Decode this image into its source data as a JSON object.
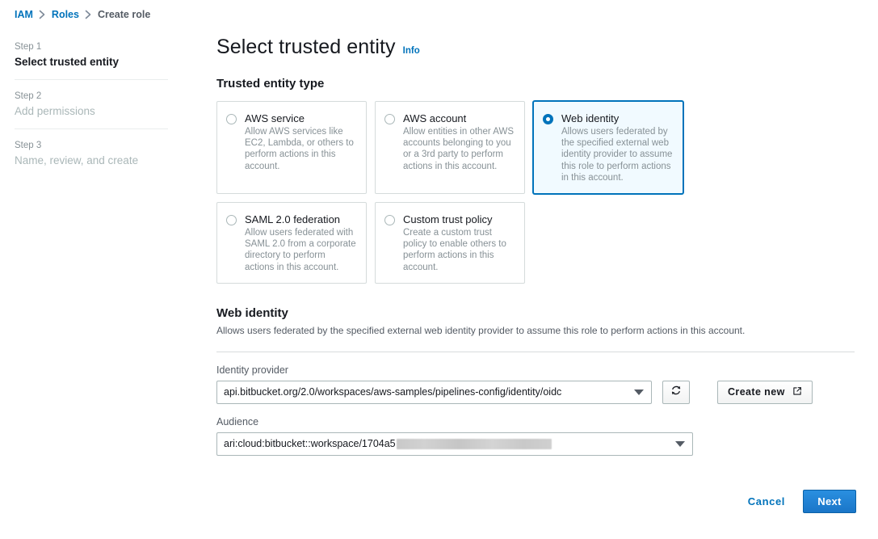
{
  "breadcrumb": {
    "items": [
      {
        "label": "IAM",
        "current": false
      },
      {
        "label": "Roles",
        "current": false
      },
      {
        "label": "Create role",
        "current": true
      }
    ]
  },
  "sidebar": {
    "steps": [
      {
        "kicker": "Step 1",
        "title": "Select trusted entity",
        "active": true
      },
      {
        "kicker": "Step 2",
        "title": "Add permissions",
        "active": false
      },
      {
        "kicker": "Step 3",
        "title": "Name, review, and create",
        "active": false
      }
    ]
  },
  "page": {
    "title": "Select trusted entity",
    "info_label": "Info",
    "section_heading": "Trusted entity type"
  },
  "entity_types": [
    {
      "title": "AWS service",
      "description": "Allow AWS services like EC2, Lambda, or others to perform actions in this account.",
      "selected": false
    },
    {
      "title": "AWS account",
      "description": "Allow entities in other AWS accounts belonging to you or a 3rd party to perform actions in this account.",
      "selected": false
    },
    {
      "title": "Web identity",
      "description": "Allows users federated by the specified external web identity provider to assume this role to perform actions in this account.",
      "selected": true
    },
    {
      "title": "SAML 2.0 federation",
      "description": "Allow users federated with SAML 2.0 from a corporate directory to perform actions in this account.",
      "selected": false
    },
    {
      "title": "Custom trust policy",
      "description": "Create a custom trust policy to enable others to perform actions in this account.",
      "selected": false
    }
  ],
  "web_identity": {
    "heading": "Web identity",
    "description": "Allows users federated by the specified external web identity provider to assume this role to perform actions in this account.",
    "identity_provider": {
      "label": "Identity provider",
      "value": "api.bitbucket.org/2.0/workspaces/aws-samples/pipelines-config/identity/oidc",
      "refresh_icon": "refresh-icon",
      "create_new_label": "Create new",
      "create_new_icon": "external-link-icon"
    },
    "audience": {
      "label": "Audience",
      "value": "ari:cloud:bitbucket::workspace/1704a5",
      "redacted": true
    }
  },
  "footer": {
    "cancel_label": "Cancel",
    "next_label": "Next"
  },
  "colors": {
    "link": "#0073bb",
    "selected_border": "#0073bb",
    "selected_background": "#f1faff",
    "primary_button": "#1a76c8",
    "muted_text": "#879196"
  }
}
